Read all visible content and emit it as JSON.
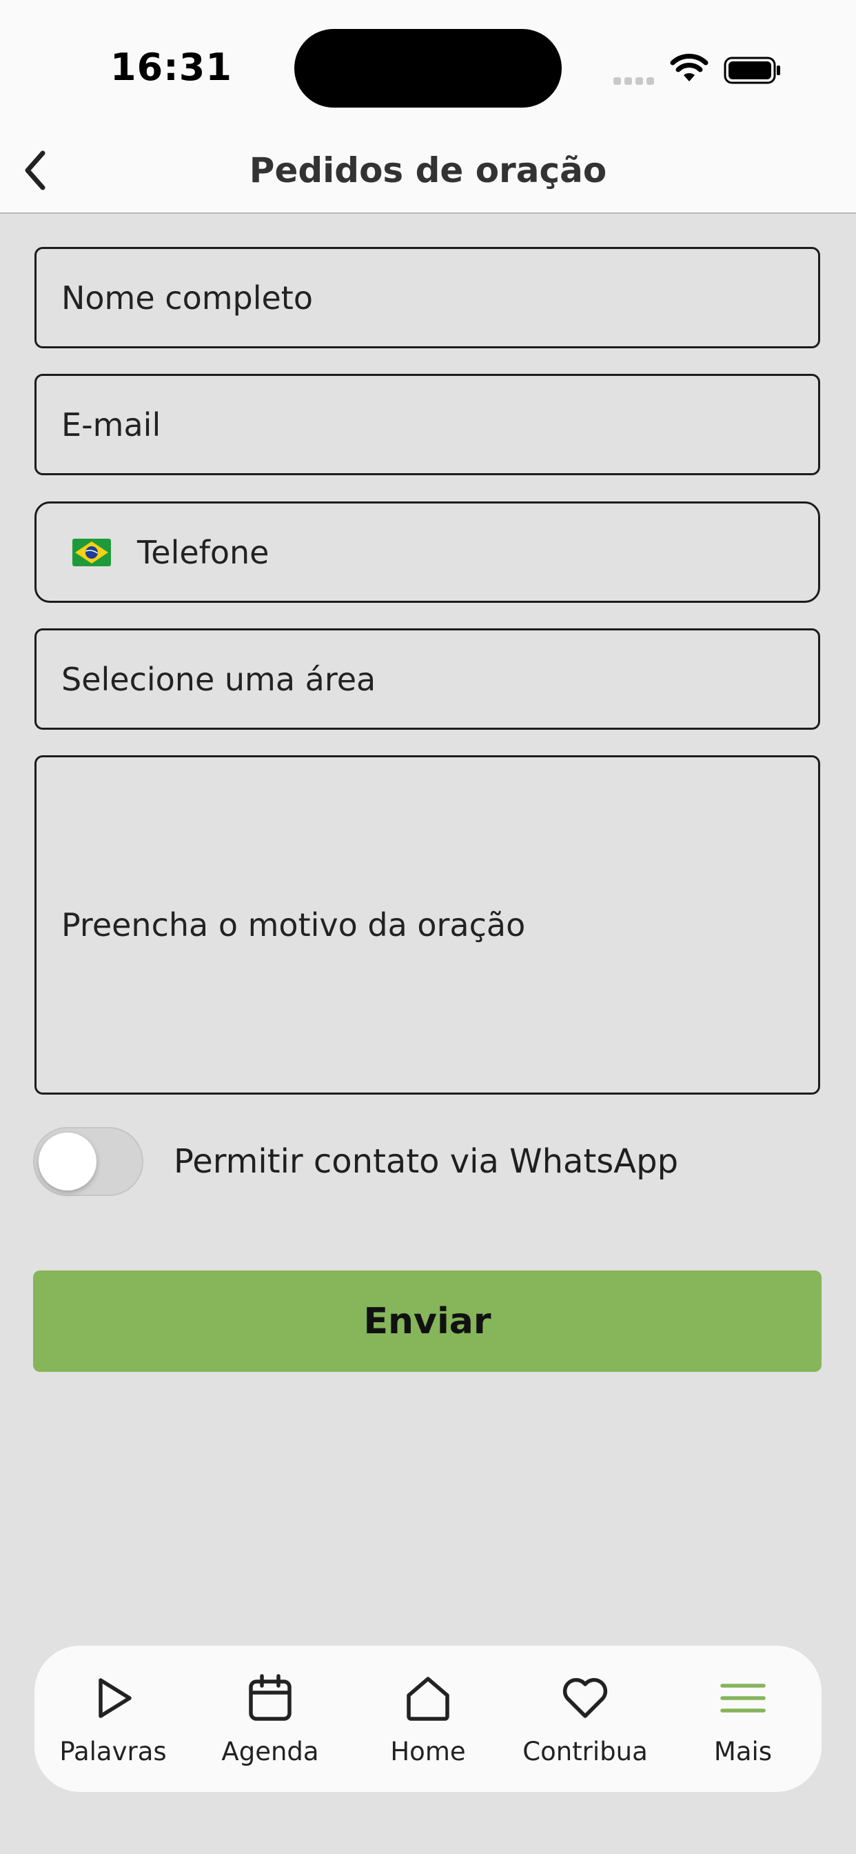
{
  "status": {
    "time": "16:31"
  },
  "header": {
    "title": "Pedidos de oração"
  },
  "form": {
    "name_placeholder": "Nome completo",
    "email_placeholder": "E-mail",
    "phone_placeholder": "Telefone",
    "area_placeholder": "Selecione uma área",
    "reason_placeholder": "Preencha o motivo da oração",
    "whatsapp_label": "Permitir contato via WhatsApp",
    "whatsapp_enabled": false,
    "submit_label": "Enviar"
  },
  "tabs": [
    {
      "label": "Palavras",
      "icon": "play-icon"
    },
    {
      "label": "Agenda",
      "icon": "calendar-icon"
    },
    {
      "label": "Home",
      "icon": "home-icon"
    },
    {
      "label": "Contribua",
      "icon": "heart-icon"
    },
    {
      "label": "Mais",
      "icon": "menu-icon",
      "active": true
    }
  ],
  "colors": {
    "accent": "#86b55a",
    "background": "#e1e1e1"
  }
}
